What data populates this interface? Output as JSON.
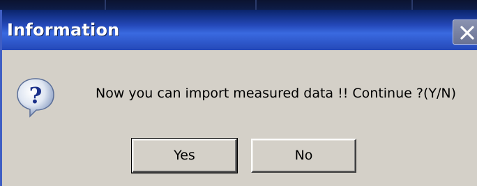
{
  "dialog": {
    "title": "Information",
    "message": "Now you can import measured data !! Continue ?(Y/N)",
    "icon": "question-icon",
    "buttons": {
      "yes_label": "Yes",
      "no_label": "No"
    }
  },
  "colors": {
    "titlebar": "#2448b8",
    "body": "#d4d0c8",
    "title_text": "#ffffff"
  }
}
